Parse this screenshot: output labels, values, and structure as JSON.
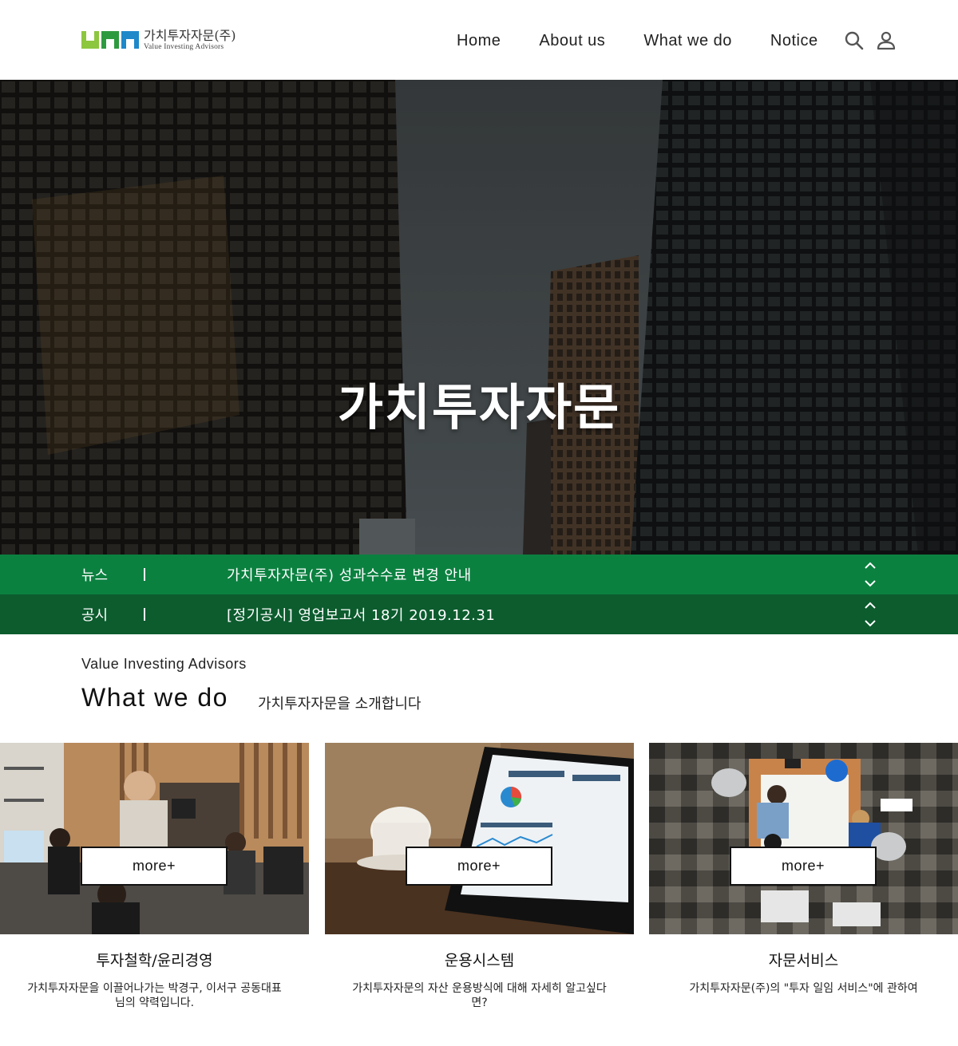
{
  "header": {
    "logo_kr": "가치투자자문(주)",
    "logo_en": "Value Investing Advisors",
    "nav": [
      {
        "label": "Home"
      },
      {
        "label": "About us"
      },
      {
        "label": "What we do"
      },
      {
        "label": "Notice"
      }
    ],
    "icons": [
      "search-icon",
      "user-icon"
    ]
  },
  "hero": {
    "title": "가치투자자문"
  },
  "tickers": {
    "news": {
      "label": "뉴스",
      "text": "가치투자자문(주) 성과수수료 변경 안내"
    },
    "notice": {
      "label": "공시",
      "text": "[정기공시] 영업보고서 18기 2019.12.31"
    }
  },
  "intro": {
    "subtitle": "Value Investing Advisors",
    "title": "What we do",
    "description": "가치투자자문을 소개합니다"
  },
  "cards": [
    {
      "more": "more+",
      "title": "투자철학/윤리경영",
      "desc": "가치투자자문을 이끌어나가는 박경구, 이서구 공동대표님의 약력입니다."
    },
    {
      "more": "more+",
      "title": "운용시스템",
      "desc": "가치투자자문의 자산 운용방식에 대해 자세히 알고싶다면?"
    },
    {
      "more": "more+",
      "title": "자문서비스",
      "desc": "가치투자자문(주)의 \"투자 일임 서비스\"에 관하여"
    }
  ],
  "colors": {
    "news_bar": "#0b8140",
    "notice_bar": "#0c5c2e",
    "logo_green_light": "#8dc63f",
    "logo_green": "#2e9a3f",
    "logo_blue": "#1e88c9"
  }
}
